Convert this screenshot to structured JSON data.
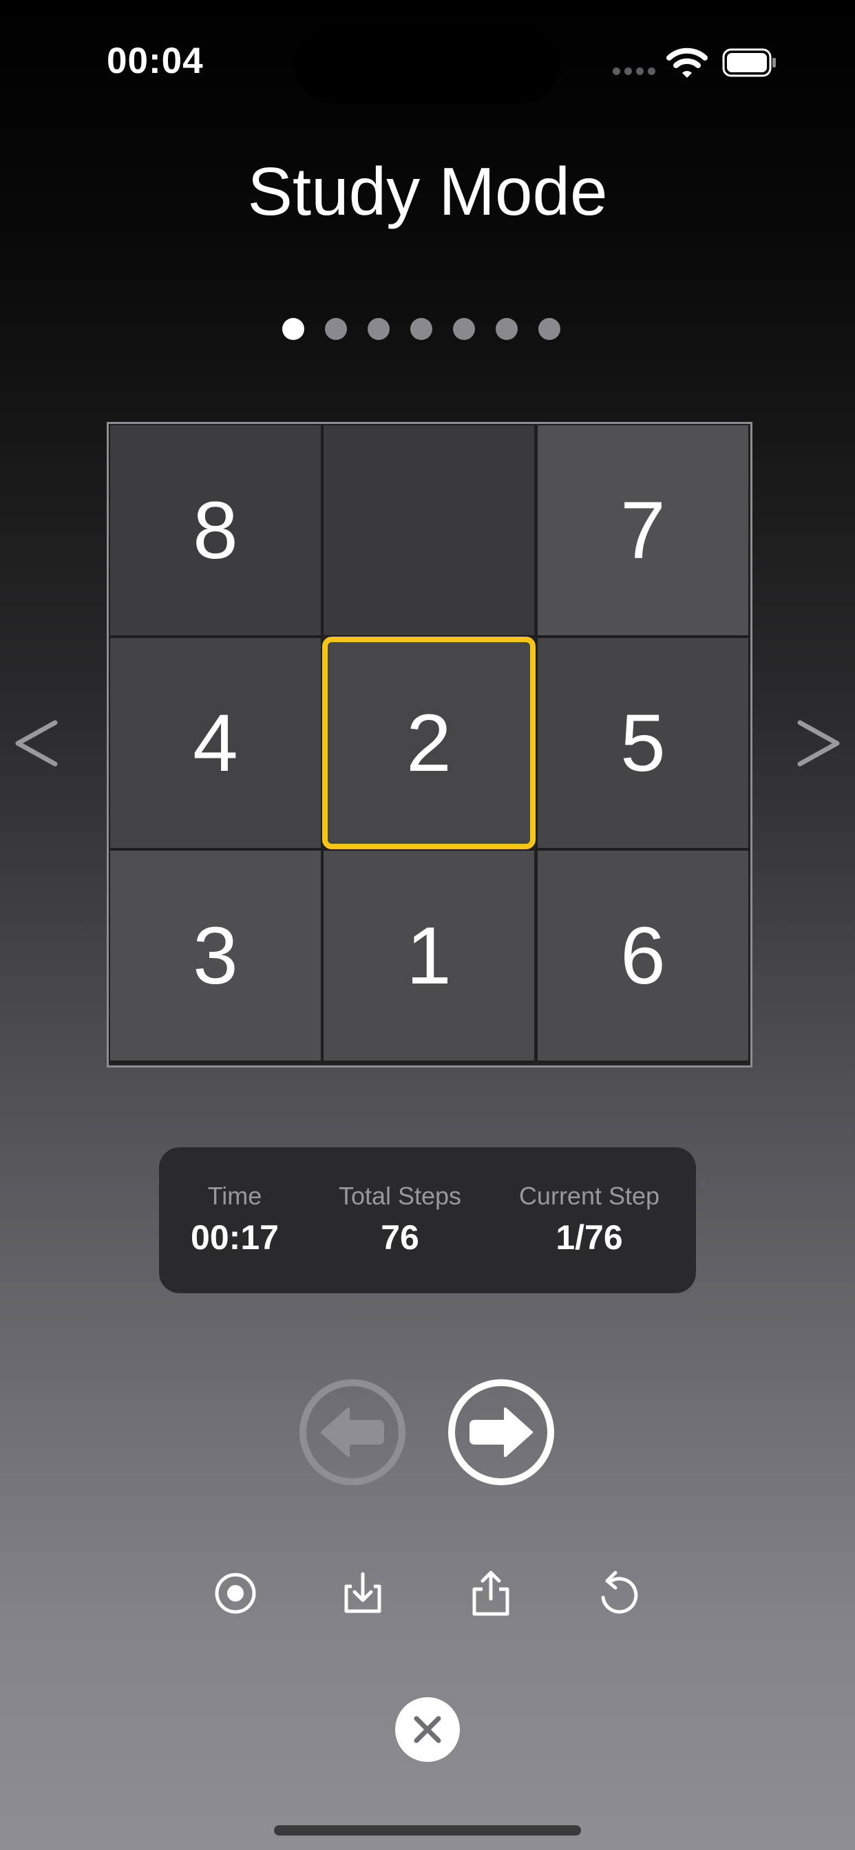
{
  "status_bar": {
    "time": "00:04"
  },
  "title": "Study Mode",
  "pager": {
    "total_pages": 7,
    "current_page": 1
  },
  "board": {
    "tiles": [
      "8",
      "",
      "7",
      "4",
      "2",
      "5",
      "3",
      "1",
      "6"
    ],
    "highlighted_tile": "2"
  },
  "stats": {
    "time_label": "Time",
    "time_value": "00:17",
    "total_steps_label": "Total Steps",
    "total_steps_value": "76",
    "current_step_label": "Current Step",
    "current_step_value": "1/76"
  },
  "icons": {
    "prev_page": "chevron-left-icon",
    "next_page": "chevron-right-icon",
    "step_back": "arrow-left-circle-icon",
    "step_forward": "arrow-right-circle-icon",
    "record": "record-icon",
    "download": "download-icon",
    "share": "share-icon",
    "reset": "undo-icon",
    "close": "close-icon"
  },
  "colors": {
    "highlight": "#f5c518",
    "card_background": "#2a2a2c",
    "disabled_button": "#8e8e93"
  }
}
